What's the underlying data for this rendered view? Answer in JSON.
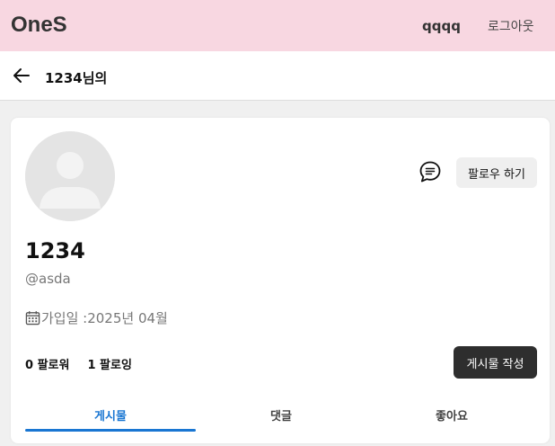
{
  "header": {
    "logo": "OneS",
    "username": "qqqq",
    "logout_label": "로그아웃"
  },
  "subheader": {
    "title": "1234님의"
  },
  "profile": {
    "name": "1234",
    "handle": "@asda",
    "joined": "가입일 :2025년 04월",
    "followers": "0 팔로워",
    "following": "1 팔로잉",
    "follow_button": "팔로우 하기",
    "write_button": "게시물 작성"
  },
  "tabs": [
    {
      "label": "게시물",
      "active": true
    },
    {
      "label": "댓글",
      "active": false
    },
    {
      "label": "좋아요",
      "active": false
    }
  ],
  "colors": {
    "header_bg": "#f8d7e1",
    "accent": "#1976d2",
    "dark_button": "#2e2e2e"
  }
}
